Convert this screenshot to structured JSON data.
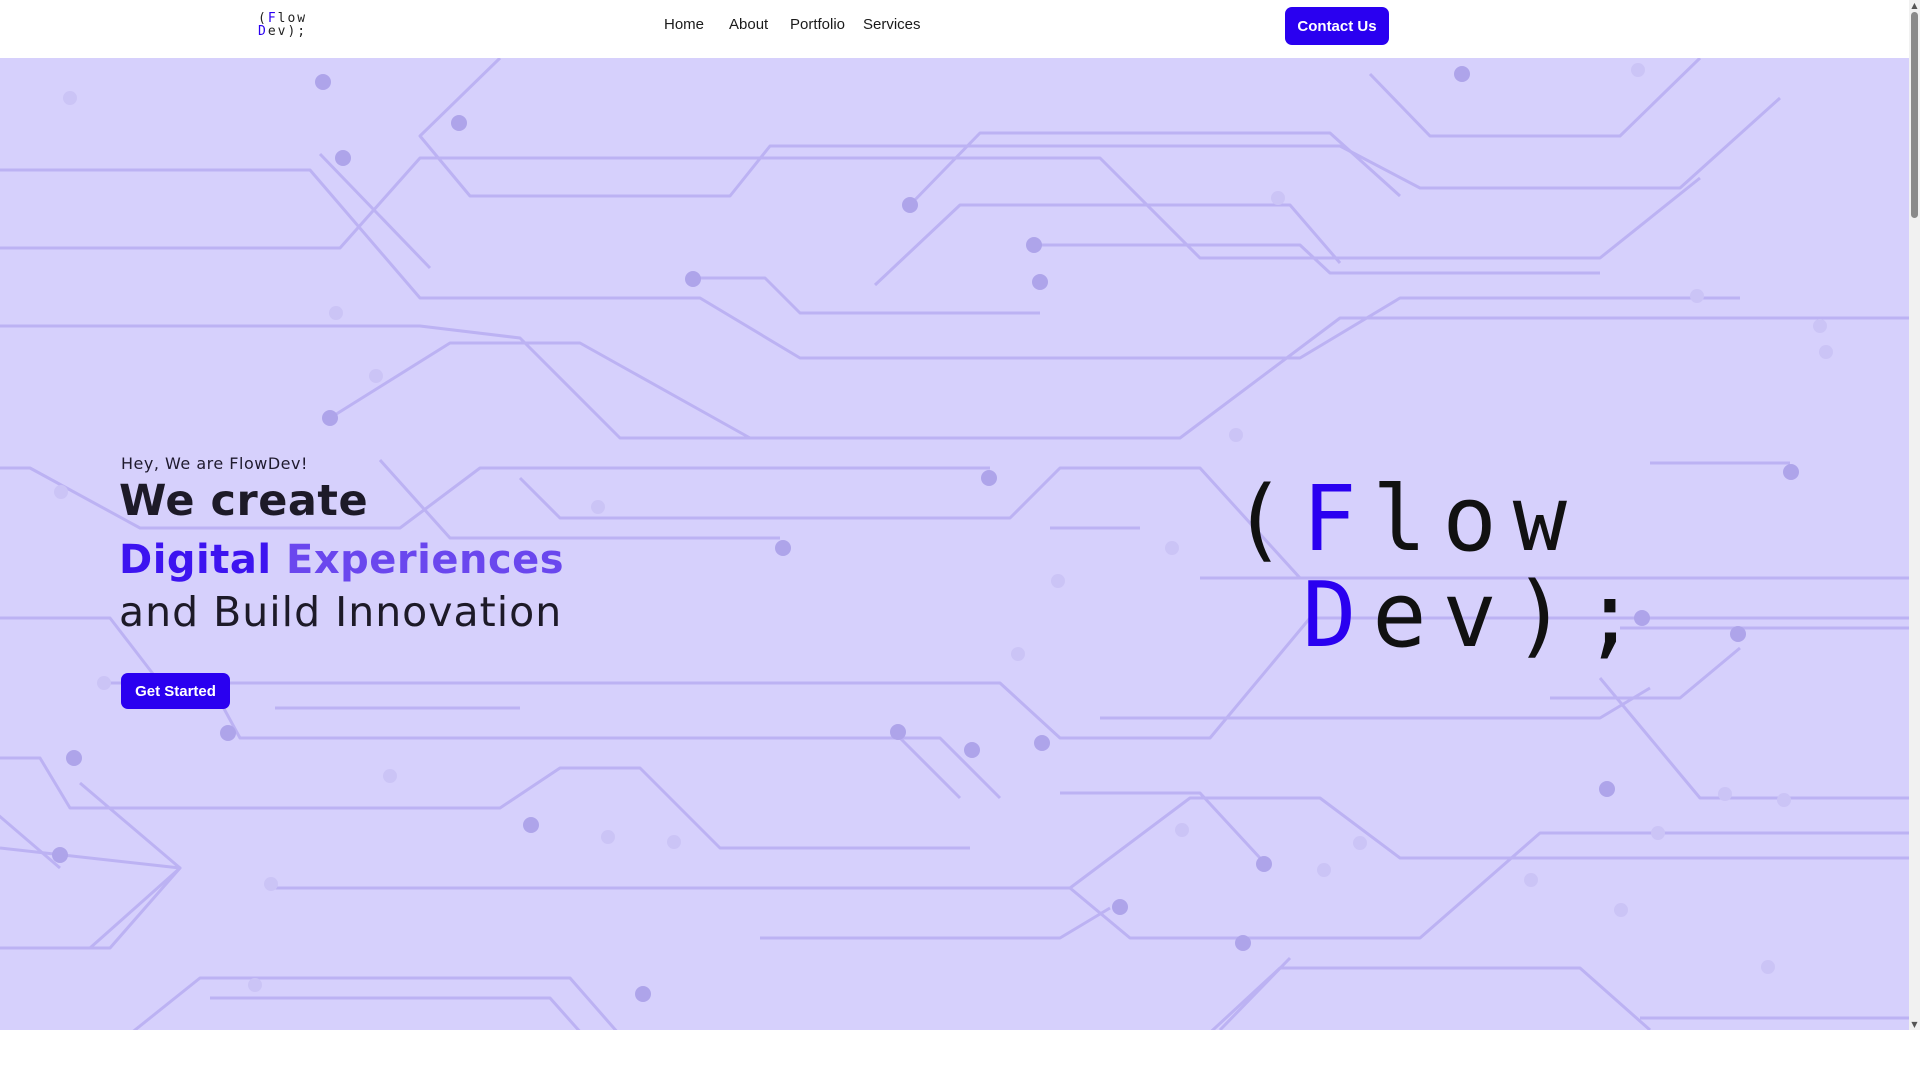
{
  "colors": {
    "accent": "#2a00f0",
    "hero_background": "#d6d0fc",
    "circuit_line": "#bcb2f3"
  },
  "logo_small": {
    "line1_pre": "(",
    "line1_accent": "F",
    "line1_post": "low",
    "line2_accent": "D",
    "line2_post": "ev);"
  },
  "nav": {
    "items": [
      {
        "label": "Home"
      },
      {
        "label": "About"
      },
      {
        "label": "Portfolio"
      },
      {
        "label": "Services"
      }
    ],
    "contact_label": "Contact Us"
  },
  "hero": {
    "tagline": "Hey, We are FlowDev!",
    "headline_line1": "We create",
    "headline_line2_word1": "Digital",
    "headline_line2_word2": "Experiences",
    "headline_line3": "and Build Innovation",
    "cta_label": "Get Started"
  },
  "big_logo": {
    "line1_pre": "(",
    "line1_accent": "F",
    "line1_post": "low",
    "line2_accent": "D",
    "line2_post": "ev);"
  },
  "scrollbar": {
    "up_icon": "triangle-up",
    "down_icon": "triangle-down"
  }
}
